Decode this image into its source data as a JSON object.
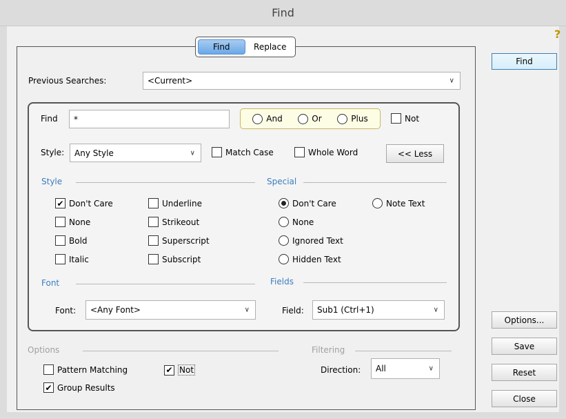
{
  "window": {
    "title": "Find"
  },
  "tabs": [
    {
      "label": "Find",
      "active": true
    },
    {
      "label": "Replace",
      "active": false
    }
  ],
  "previous_searches": {
    "label": "Previous Searches:",
    "value": "<Current>"
  },
  "find_row": {
    "label": "Find",
    "value": "*",
    "bool_options": [
      {
        "label": "And",
        "selected": false
      },
      {
        "label": "Or",
        "selected": false
      },
      {
        "label": "Plus",
        "selected": false
      }
    ],
    "not": {
      "label": "Not",
      "checked": false
    }
  },
  "style_row": {
    "label": "Style:",
    "value": "Any Style",
    "match_case": {
      "label": "Match Case",
      "checked": false
    },
    "whole_word": {
      "label": "Whole Word",
      "checked": false
    },
    "less_button": "<< Less"
  },
  "style_group": {
    "title": "Style",
    "options": [
      {
        "label": "Don't Care",
        "checked": true
      },
      {
        "label": "None",
        "checked": false
      },
      {
        "label": "Bold",
        "checked": false
      },
      {
        "label": "Italic",
        "checked": false
      },
      {
        "label": "Underline",
        "checked": false
      },
      {
        "label": "Strikeout",
        "checked": false
      },
      {
        "label": "Superscript",
        "checked": false
      },
      {
        "label": "Subscript",
        "checked": false
      }
    ]
  },
  "special_group": {
    "title": "Special",
    "options": [
      {
        "label": "Don't Care",
        "selected": true
      },
      {
        "label": "None",
        "selected": false
      },
      {
        "label": "Ignored Text",
        "selected": false
      },
      {
        "label": "Hidden Text",
        "selected": false
      },
      {
        "label": "Note Text",
        "selected": false
      }
    ]
  },
  "font_group": {
    "title": "Font",
    "label": "Font:",
    "value": "<Any Font>"
  },
  "fields_group": {
    "title": "Fields",
    "label": "Field:",
    "value": "Sub1  (Ctrl+1)"
  },
  "options_group": {
    "title": "Options",
    "pattern_matching": {
      "label": "Pattern Matching",
      "checked": false
    },
    "not": {
      "label": "Not",
      "checked": true
    },
    "group_results": {
      "label": "Group Results",
      "checked": true
    }
  },
  "filtering_group": {
    "title": "Filtering",
    "label": "Direction:",
    "value": "All"
  },
  "side_buttons": {
    "find": "Find",
    "options": "Options...",
    "save": "Save",
    "reset": "Reset",
    "close": "Close"
  },
  "icons": {
    "help": "help-icon",
    "chevron": "chevron-down-icon",
    "check": "check-icon"
  }
}
